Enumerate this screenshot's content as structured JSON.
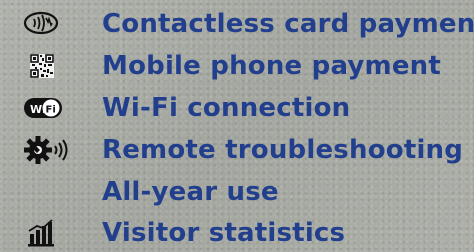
{
  "colors": {
    "label_text": "#213f8c",
    "icon": "#111111",
    "background": "#a7a9a3"
  },
  "features": [
    {
      "label": "Contactless card payment",
      "icon": "contactless-card-icon"
    },
    {
      "label": "Mobile phone payment",
      "icon": "qr-code-icon"
    },
    {
      "label": "Wi-Fi connection",
      "icon": "wifi-badge-icon"
    },
    {
      "label": "Remote troubleshooting",
      "icon": "remote-gear-icon"
    },
    {
      "label": "All-year use",
      "icon": ""
    },
    {
      "label": "Visitor statistics",
      "icon": "bar-chart-icon"
    }
  ],
  "wifi_badge_text": "Wi Fi"
}
